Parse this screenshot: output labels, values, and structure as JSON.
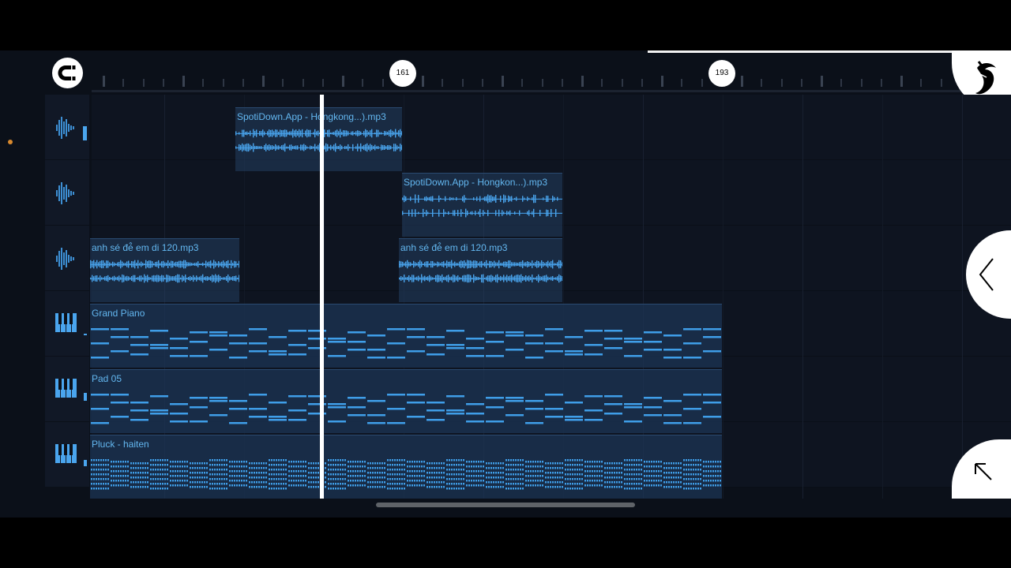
{
  "ruler": {
    "markers": [
      "161",
      "193"
    ]
  },
  "toolbar": {
    "magnet_icon": "magnet-icon",
    "logo_icon": "fl-studio-fruit-logo-icon",
    "back_icon": "chevron-left-icon",
    "fullscreen_icon": "arrow-up-left-icon"
  },
  "tracks": [
    {
      "icon": "audio-waveform-icon",
      "type": "audio"
    },
    {
      "icon": "audio-waveform-icon",
      "type": "audio"
    },
    {
      "icon": "audio-waveform-icon",
      "type": "audio"
    },
    {
      "icon": "piano-keys-icon",
      "type": "instrument"
    },
    {
      "icon": "piano-keys-icon",
      "type": "instrument"
    },
    {
      "icon": "piano-keys-icon",
      "type": "instrument"
    }
  ],
  "clips": [
    {
      "label": "SpotiDown.App - Hongkong...).mp3"
    },
    {
      "label": "SpotiDown.App - Hongkon...).mp3"
    },
    {
      "label": "anh sé đé̂ em di 120.mp3"
    },
    {
      "label": "anh sé đé̂ em di 120.mp3"
    },
    {
      "label": "Grand Piano"
    },
    {
      "label": "Pad 05"
    },
    {
      "label": "Pluck - haiten"
    }
  ],
  "colors": {
    "accent": "#63b7f0",
    "status_dot": "#d8892e",
    "playhead": "#ffffff"
  }
}
